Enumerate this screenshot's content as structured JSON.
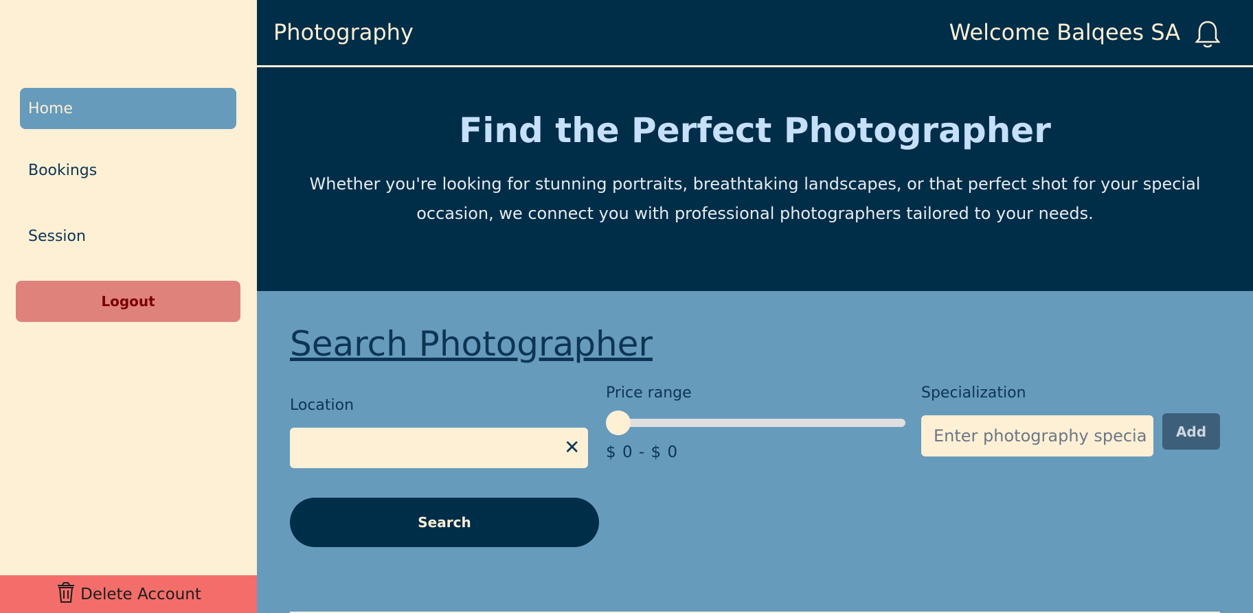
{
  "sidebar": {
    "items": [
      {
        "label": "Home"
      },
      {
        "label": "Bookings"
      },
      {
        "label": "Session"
      }
    ],
    "logout_label": "Logout",
    "delete_label": "Delete Account"
  },
  "header": {
    "title": "Photography",
    "welcome": "Welcome Balqees SA"
  },
  "hero": {
    "heading": "Find the Perfect Photographer",
    "description": "Whether you're looking for stunning portraits, breathtaking landscapes, or that perfect shot for your special occasion, we connect you with professional photographers tailored to your needs."
  },
  "search": {
    "heading": "Search Photographer",
    "location_label": "Location",
    "location_value": "",
    "price_label": "Price range",
    "price_text": "$ 0 - $ 0",
    "specialization_label": "Specialization",
    "specialization_placeholder": "Enter photography specia",
    "add_label": "Add",
    "search_label": "Search",
    "clear_symbol": "✕"
  },
  "colors": {
    "navy": "#002d48",
    "cream": "#fdf0d5",
    "steel_blue": "#669bbc",
    "logout_bg": "#e0827c",
    "delete_bg": "#f36e6a"
  }
}
